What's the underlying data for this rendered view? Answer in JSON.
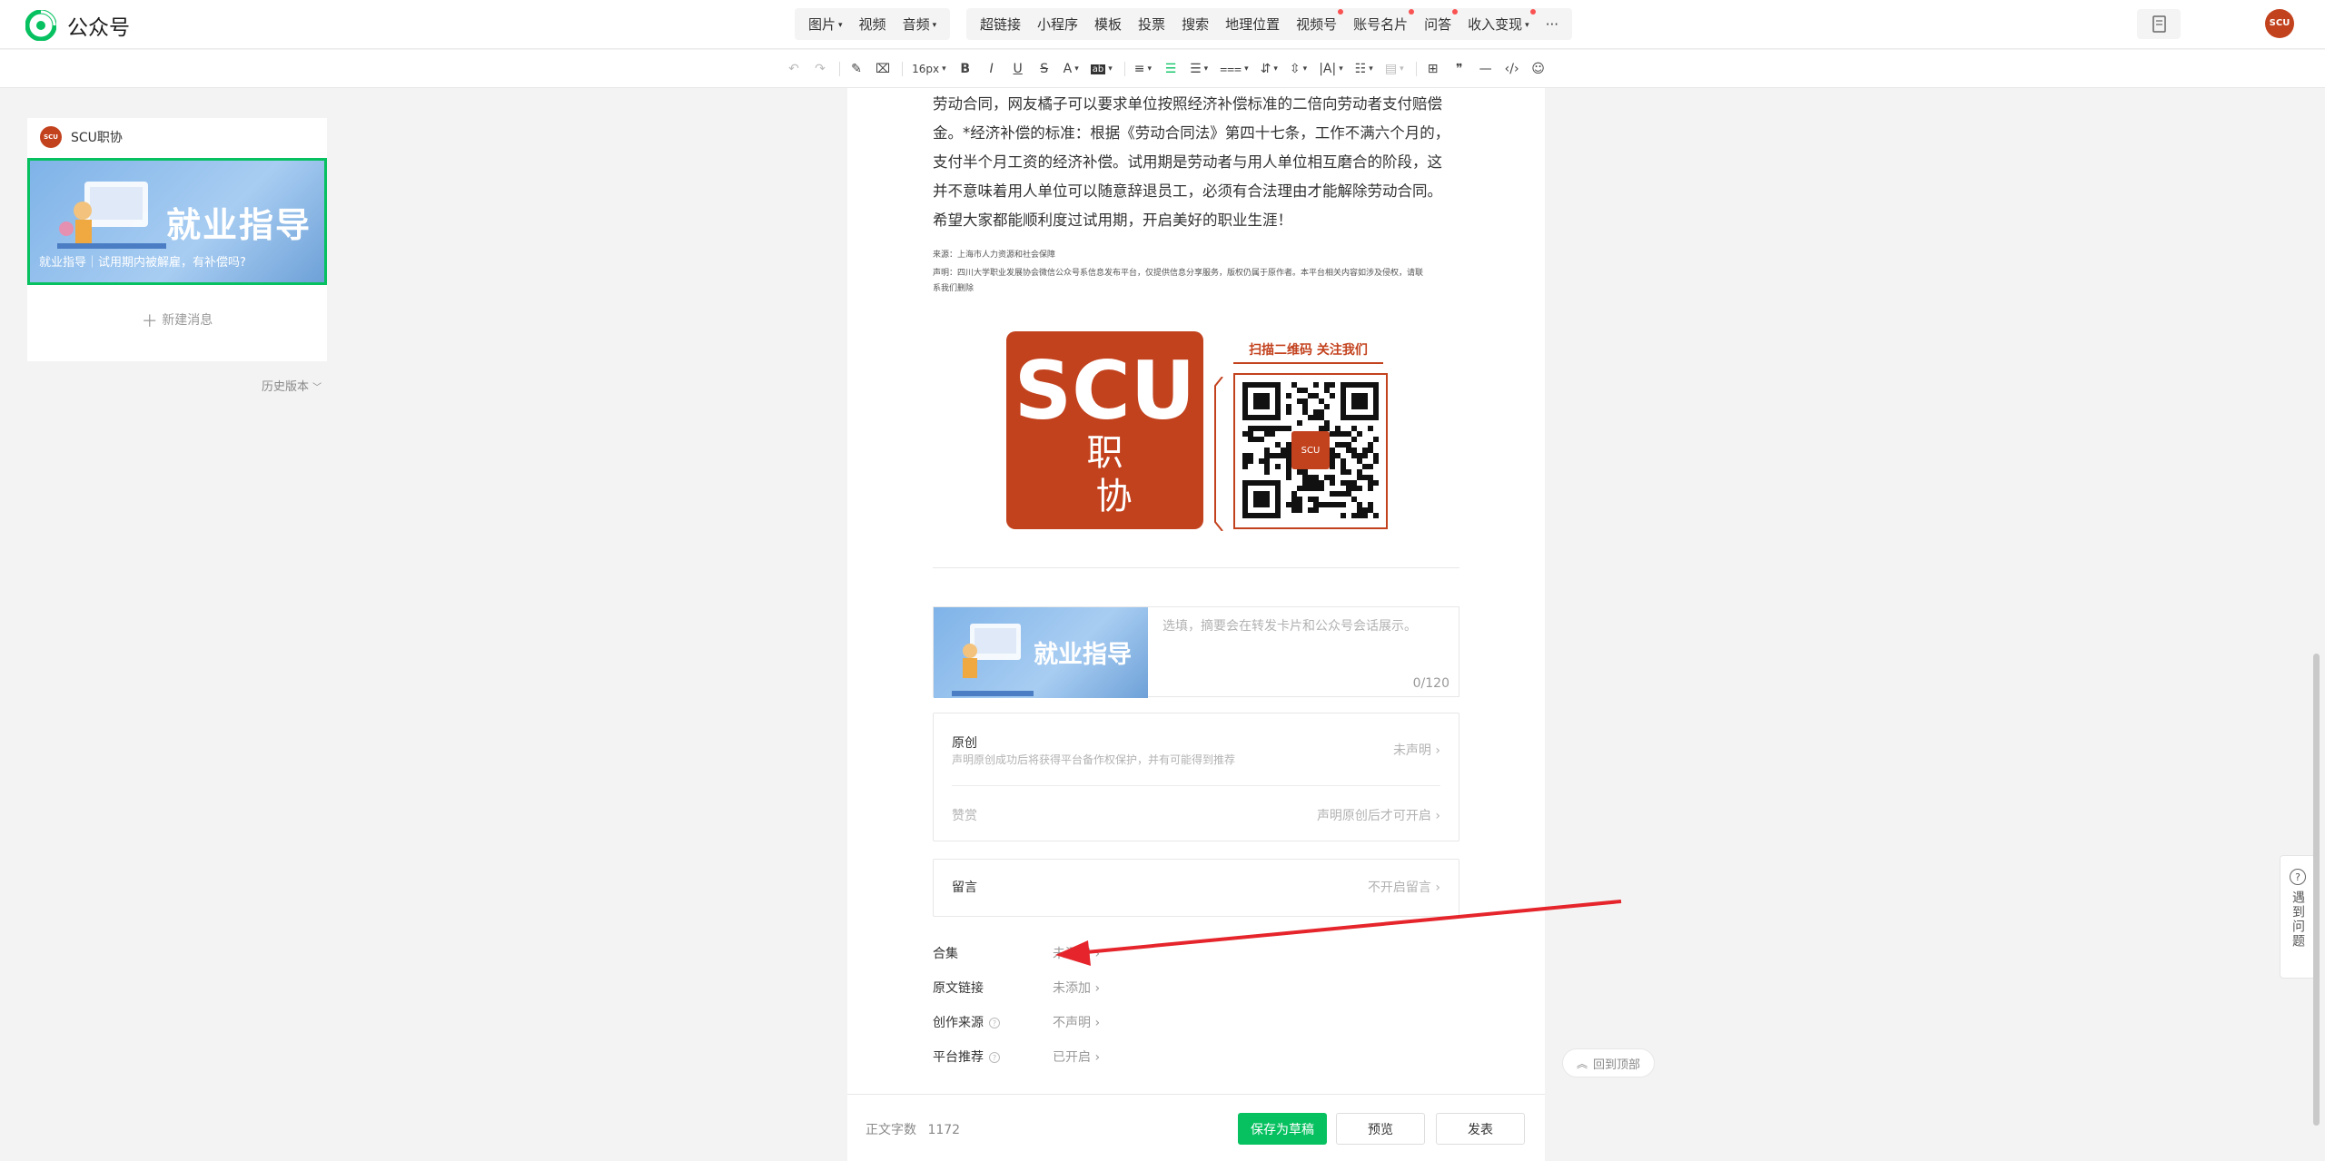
{
  "header": {
    "brand": "公众号",
    "menu_group1": [
      {
        "label": "图片",
        "caret": true
      },
      {
        "label": "视频",
        "caret": false
      },
      {
        "label": "音频",
        "caret": true
      }
    ],
    "menu_group2": [
      {
        "label": "超链接",
        "caret": false,
        "dot": false
      },
      {
        "label": "小程序",
        "caret": false,
        "dot": false
      },
      {
        "label": "模板",
        "caret": false,
        "dot": false
      },
      {
        "label": "投票",
        "caret": false,
        "dot": false
      },
      {
        "label": "搜索",
        "caret": false,
        "dot": false
      },
      {
        "label": "地理位置",
        "caret": false,
        "dot": false
      },
      {
        "label": "视频号",
        "caret": false,
        "dot": true
      },
      {
        "label": "账号名片",
        "caret": false,
        "dot": true
      },
      {
        "label": "问答",
        "caret": false,
        "dot": true
      },
      {
        "label": "收入变现",
        "caret": true,
        "dot": true
      }
    ],
    "more": "···",
    "avatar_text": "SCU"
  },
  "toolbar": {
    "font_size": "16px",
    "caret": "·"
  },
  "sidebar": {
    "account_name": "SCU职协",
    "account_avatar": "SCU",
    "cover_title": "就业指导",
    "cover_caption": "就业指导｜试用期内被解雇，有补偿吗?",
    "new_message": "新建消息",
    "history": "历史版本"
  },
  "article": {
    "lines": [
      "劳动合同，网友橘子可以要求单位按照经济补偿标准的二倍向劳动者支付赔偿",
      "金。*经济补偿的标准：根据《劳动合同法》第四十七条，工作不满六个月的，",
      "支付半个月工资的经济补偿。试用期是劳动者与用人单位相互磨合的阶段，这",
      "并不意味着用人单位可以随意辞退员工，必须有合法理由才能解除劳动合同。",
      "希望大家都能顺利度过试用期，开启美好的职业生涯！"
    ],
    "source": "来源：上海市人力资源和社会保障",
    "statement1": "声明：四川大学职业发展协会微信公众号系信息发布平台，仅提供信息分享服务，版权仍属于原作者。本平台相关内容如涉及侵权，请联",
    "statement2": "系我们删除",
    "promo_scu": "SCU",
    "promo_zx1": "职",
    "promo_zx2": "协",
    "promo_scan": "扫描二维码 关注我们",
    "qr_center": "SCU"
  },
  "digest": {
    "cover_title": "就业指导",
    "placeholder": "选填，摘要会在转发卡片和公众号会话展示。",
    "count": "0/120"
  },
  "settings": {
    "original_title": "原创",
    "original_desc": "声明原创成功后将获得平台备作权保护，并有可能得到推荐",
    "original_value": "未声明 ›",
    "reward_title": "赞赏",
    "reward_value": "声明原创后才可开启 ›",
    "comment_title": "留言",
    "comment_value": "不开启留言 ›",
    "collection_label": "合集",
    "collection_value": "未添加 ›",
    "link_label": "原文链接",
    "link_value": "未添加 ›",
    "source_label": "创作来源",
    "source_value": "不声明 ›",
    "recommend_label": "平台推荐",
    "recommend_value": "已开启 ›"
  },
  "footer": {
    "word_count_label": "正文字数",
    "word_count": "1172",
    "save": "保存为草稿",
    "preview": "预览",
    "publish": "发表"
  },
  "floating": {
    "back_top": "回到顶部",
    "help": "遇到问题"
  },
  "colors": {
    "accent": "#07c160",
    "brand_red": "#c3421e",
    "annotation_arrow": "#e5252b"
  }
}
